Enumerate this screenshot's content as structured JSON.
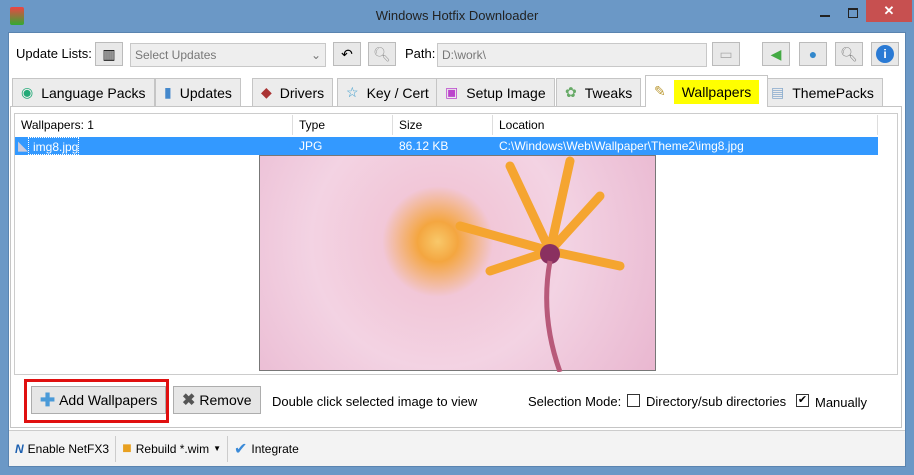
{
  "window": {
    "title": "Windows Hotfix Downloader"
  },
  "toolbar": {
    "update_lists_label": "Update Lists:",
    "select_placeholder": "Select Updates",
    "path_label": "Path:",
    "path_value": "D:\\work\\"
  },
  "tabs": [
    {
      "label": "Language Packs"
    },
    {
      "label": "Updates"
    },
    {
      "label": "Drivers"
    },
    {
      "label": "Key / Cert"
    },
    {
      "label": "Setup Image"
    },
    {
      "label": "Tweaks"
    },
    {
      "label": "Wallpapers"
    },
    {
      "label": "ThemePacks"
    }
  ],
  "list": {
    "headers": [
      "Wallpapers: 1",
      "Type",
      "Size",
      "Location"
    ],
    "rows": [
      {
        "name": "img8.jpg",
        "type": "JPG",
        "size": "86.12 KB",
        "location": "C:\\Windows\\Web\\Wallpaper\\Theme2\\img8.jpg"
      }
    ]
  },
  "actions": {
    "add": "Add Wallpapers",
    "remove": "Remove",
    "hint": "Double click selected image to view",
    "selection_mode": "Selection Mode:",
    "directory_option": "Directory/sub directories",
    "manual_option": "Manually",
    "directory_checked": false,
    "manual_checked": true
  },
  "status": {
    "netfx": "Enable NetFX3",
    "rebuild": "Rebuild *.wim",
    "integrate": "Integrate"
  },
  "colors": {
    "selection": "#3399ff",
    "highlight": "#ffff00",
    "close": "#c75050"
  }
}
